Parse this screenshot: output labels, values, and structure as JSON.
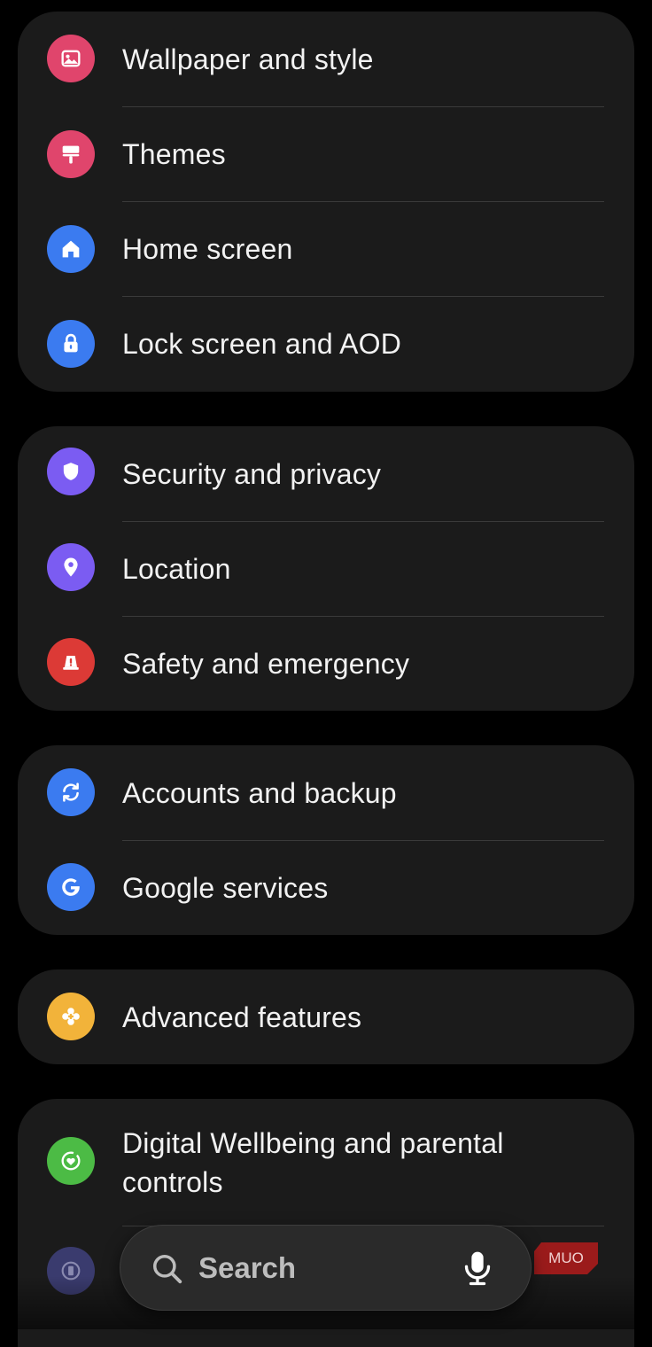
{
  "colors": {
    "pink": "#e0456c",
    "blue": "#3b7bf0",
    "purple": "#7b5cf2",
    "red": "#dc3a36",
    "yellow": "#f2b33a",
    "green": "#4cbb45",
    "dim_indigo": "#3a3b6e"
  },
  "groups": [
    {
      "items": [
        {
          "label": "Wallpaper and style",
          "icon": "wallpaper-icon"
        },
        {
          "label": "Themes",
          "icon": "paintbrush-icon"
        },
        {
          "label": "Home screen",
          "icon": "home-icon"
        },
        {
          "label": "Lock screen and AOD",
          "icon": "lock-icon"
        }
      ]
    },
    {
      "items": [
        {
          "label": "Security and privacy",
          "icon": "shield-icon"
        },
        {
          "label": "Location",
          "icon": "location-pin-icon"
        },
        {
          "label": "Safety and emergency",
          "icon": "emergency-siren-icon"
        }
      ]
    },
    {
      "items": [
        {
          "label": "Accounts and backup",
          "icon": "sync-icon"
        },
        {
          "label": "Google services",
          "icon": "google-icon"
        }
      ]
    },
    {
      "items": [
        {
          "label": "Advanced features",
          "icon": "gear-plus-icon"
        }
      ]
    },
    {
      "items": [
        {
          "label": "Digital Wellbeing and parental controls",
          "icon": "wellbeing-icon"
        },
        {
          "label": "",
          "icon": "battery-care-icon"
        }
      ]
    }
  ],
  "search": {
    "placeholder": "Search",
    "search_icon": "search-icon",
    "mic_icon": "mic-icon"
  },
  "watermark": {
    "text": "MUO"
  }
}
